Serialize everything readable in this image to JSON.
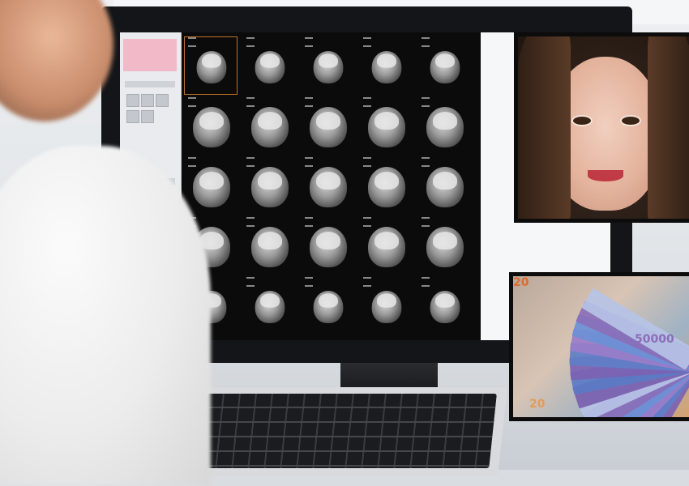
{
  "scene": {
    "description_tags": [
      "doctor-viewing-mri",
      "portrait-inset",
      "banknotes-inset"
    ]
  },
  "monitor": {
    "scan_count": 25,
    "scan_rows": 5,
    "scan_cols": 5
  },
  "insets": {
    "portrait": {
      "subject": "smiling-woman"
    },
    "money": {
      "notes": [
        {
          "label": "20",
          "color": "#e06a2c"
        },
        {
          "label": "50000",
          "color": "#8a6fb8"
        },
        {
          "label": "20",
          "color": "#e79a55"
        }
      ]
    }
  },
  "colors": {
    "accent_frame": "#0c0c0c",
    "screen_bg": "#0b0b0c",
    "selected_scan": "#c0702a"
  }
}
